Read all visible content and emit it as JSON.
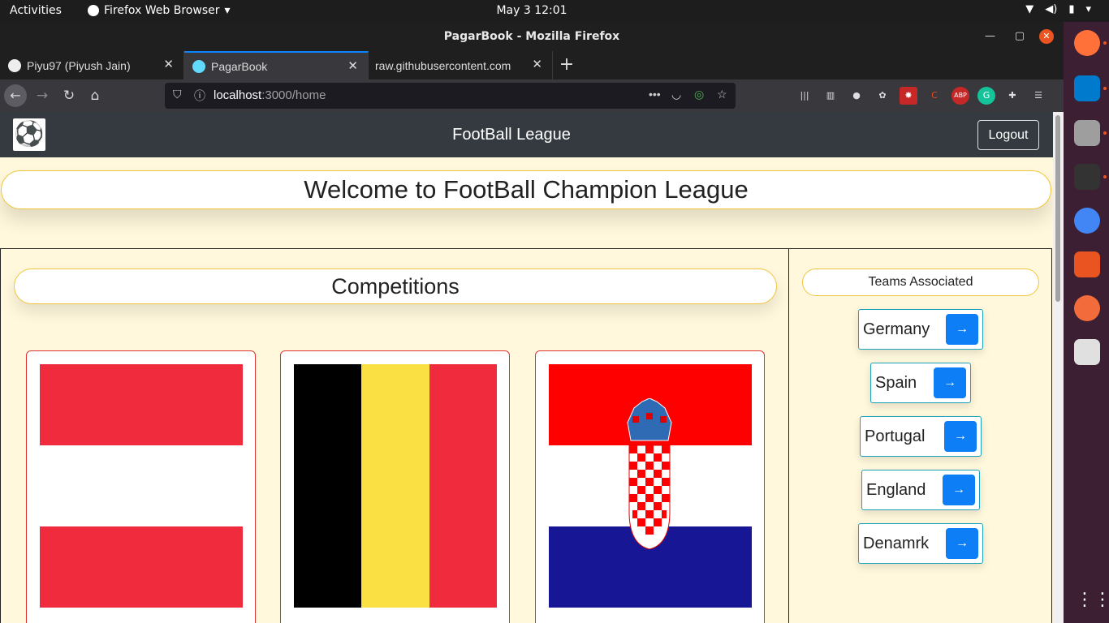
{
  "system": {
    "activities": "Activities",
    "app_menu": "Firefox Web Browser",
    "clock": "May 3  12:01"
  },
  "window": {
    "title": "PagarBook - Mozilla Firefox"
  },
  "tabs": [
    {
      "label": "Piyu97 (Piyush Jain)"
    },
    {
      "label": "PagarBook"
    },
    {
      "label": "raw.githubusercontent.com"
    }
  ],
  "url": {
    "host": "localhost",
    "path": ":3000/home"
  },
  "app": {
    "brand": "FootBall League",
    "logout": "Logout",
    "welcome": "Welcome to FootBall Champion League",
    "competitions_title": "Competitions",
    "teams_title": "Teams Associated",
    "teams": [
      {
        "name": "Germany",
        "arrow": "→"
      },
      {
        "name": "Spain",
        "arrow": "→"
      },
      {
        "name": "Portugal",
        "arrow": "→"
      },
      {
        "name": "England",
        "arrow": "→"
      },
      {
        "name": "Denamrk",
        "arrow": "→"
      }
    ]
  },
  "colors": {
    "accent": "#0d7ef5",
    "header": "#343a40",
    "page_bg": "#fff8dc",
    "border_gold": "#f0c53b"
  }
}
